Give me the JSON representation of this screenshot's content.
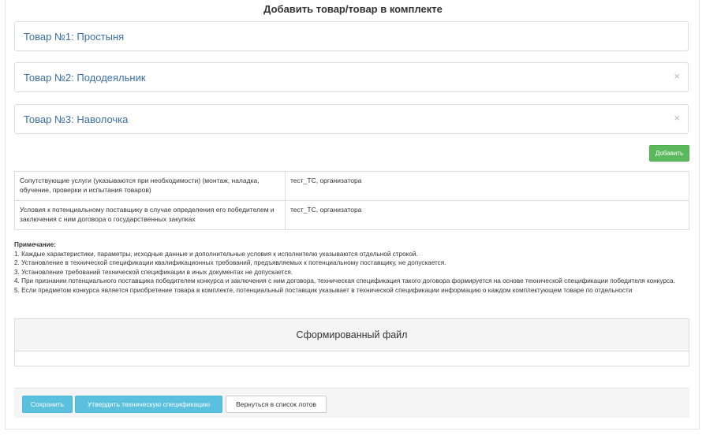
{
  "page": {
    "title": "Добавить товар/товар в комплекте"
  },
  "products": [
    {
      "label": "Товар №1: Простыня",
      "removable": false
    },
    {
      "label": "Товар №2: Пододеяльник",
      "removable": true,
      "close_symbol": "×"
    },
    {
      "label": "Товар №3: Наволочка",
      "removable": true,
      "close_symbol": "×"
    }
  ],
  "add_button": {
    "label": "Добавить"
  },
  "info_table": {
    "rows": [
      {
        "name": "Сопутствующие услуги (указываются при необходимости) (монтаж, наладка, обучение, проверки и испытания товаров)",
        "value": "тест_ТС, организатора"
      },
      {
        "name": "Условия к потенциальному поставщику в случае определения его победителем и заключения с ним договора о государственных закупках",
        "value": "тест_ТС, организатора"
      }
    ]
  },
  "notes": {
    "heading": "Примечание:",
    "items": [
      "1. Каждые характеристики, параметры, исходные данные и дополнительные условия к исполнителю указываются отдельной строкой.",
      "2. Установление в технической спецификации квалификационных требований, предъявляемых к потенциальному поставщику, не допускается.",
      "3. Установление требований технической спецификации в иных документах не допускается.",
      "4. При признании потенциального поставщика победителем конкурса и заключения с ним договора, техническая спецификация такого договора формируется на основе технической спецификации победителя конкурса.",
      "5. Если предметом конкурса является приобретение товара в комплекте, потенциальный поставщик указывает в технической спецификации информацию о каждом комплектующем товаре по отдельности"
    ]
  },
  "file_panel": {
    "heading": "Сформированный файл"
  },
  "footer": {
    "save_label": "Сохранить",
    "approve_label": "Утвердить техническую спецификацию",
    "back_label": "Вернуться в список лотов"
  },
  "colors": {
    "link": "#3a6fa8",
    "success": "#5cb85c",
    "info": "#5bc0de"
  }
}
